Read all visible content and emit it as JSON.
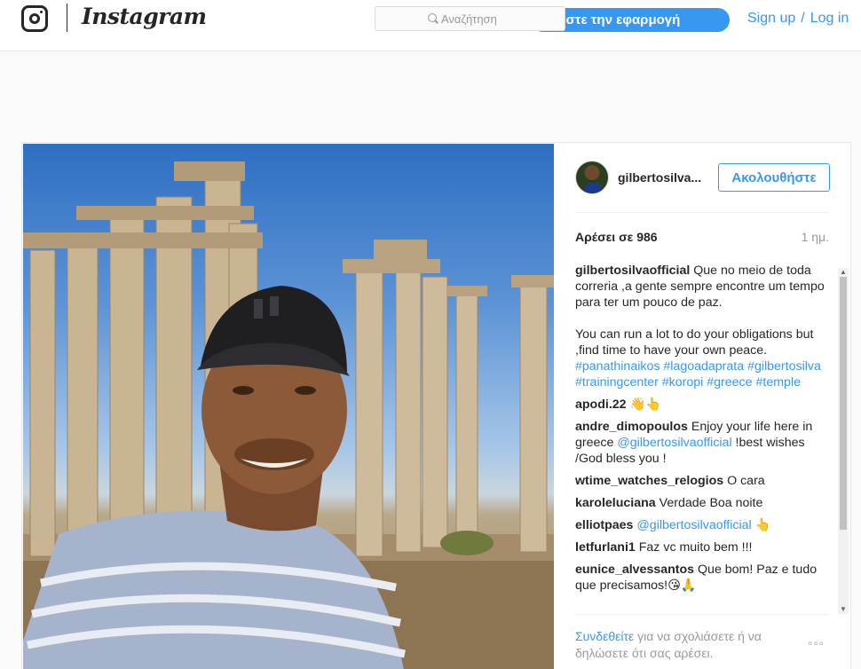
{
  "header": {
    "brand_name": "Instagram",
    "search": {
      "placeholder": "Αναζήτηση"
    },
    "get_app_label": "εβάστε την εφαρμογή",
    "signup_label": "Sign up",
    "separator": "/",
    "login_label": "Log in"
  },
  "post": {
    "author": "gilbertosilva...",
    "follow_label": "Ακολουθήστε",
    "likes": "Αρέσει σε 986",
    "time_ago": "1 ημ.",
    "comments": [
      {
        "user": "gilbertosilvaofficial",
        "text": " Que no meio de toda correria ,a gente sempre encontre um tempo para ter um pouco de paz.\n\nYou can run a lot to do your obligations but ,find time to have your own peace.",
        "tags": "#panathinaikos #lagoadaprata #gilbertosilva #trainingcenter #koropi #greece #temple"
      },
      {
        "user": "apodi.22",
        "text": " 👋👆"
      },
      {
        "user": "andre_dimopoulos",
        "text": " Enjoy your life here in greece ",
        "mention": "@gilbertosilvaofficial",
        "text_after": " !best wishes /God bless you !"
      },
      {
        "user": "wtime_watches_relogios",
        "text": " O cara"
      },
      {
        "user": "karoleluciana",
        "text": " Verdade Boa noite"
      },
      {
        "user": "elliotpaes",
        "text": " ",
        "mention": "@gilbertosilvaofficial",
        "text_after": " 👆"
      },
      {
        "user": "letfurlani1",
        "text": " Faz vc muito bem !!!"
      },
      {
        "user": "eunice_alvessantos",
        "text": " Que bom! Paz e tudo que precisamos!😘🙏"
      }
    ],
    "footer": {
      "login_link": "Συνδεθείτε",
      "prompt_rest": " για να σχολιάσετε ή να δηλώσετε ότι σας αρέσει.",
      "more": "◦◦◦"
    }
  },
  "icons": {
    "logo": "instagram-camera-icon",
    "search": "search-icon",
    "more": "more-options-icon"
  },
  "colors": {
    "accent": "#3897f0",
    "text": "#262626",
    "muted": "#999999",
    "background": "#fafafa"
  }
}
